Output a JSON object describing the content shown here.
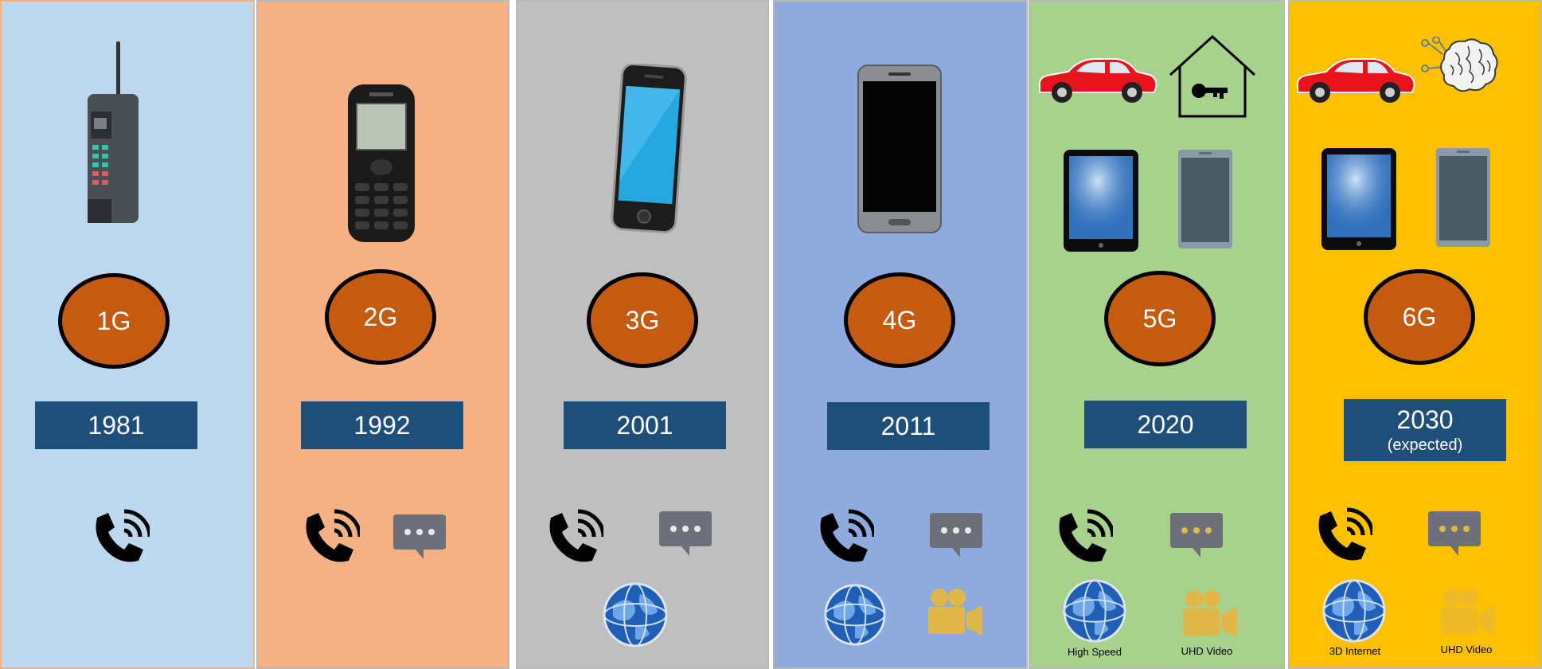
{
  "generations": [
    {
      "gen": "1G",
      "year": "1981",
      "year_note": ""
    },
    {
      "gen": "2G",
      "year": "1992",
      "year_note": ""
    },
    {
      "gen": "3G",
      "year": "2001",
      "year_note": ""
    },
    {
      "gen": "4G",
      "year": "2011",
      "year_note": ""
    },
    {
      "gen": "5G",
      "year": "2020",
      "year_note": "",
      "captions": [
        "High Speed",
        "UHD Video"
      ]
    },
    {
      "gen": "6G",
      "year": "2030",
      "year_note": "(expected)",
      "captions": [
        "3D Internet",
        "UHD Video"
      ]
    }
  ],
  "colors": {
    "panel_1g": "#bdd7ee",
    "panel_2g": "#f4b183",
    "panel_3g": "#bfbfbf",
    "panel_4g": "#8faadc",
    "panel_5g": "#a9d18e",
    "panel_6g": "#ffc000",
    "circle": "#c55a11",
    "year_box": "#1f4e79"
  }
}
